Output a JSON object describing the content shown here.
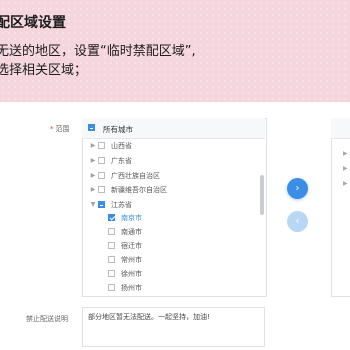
{
  "header": {
    "title": "配区域设置",
    "desc_line1": "无送的地区，设置“临时禁配区域”,",
    "desc_line2": "选择相关区域；"
  },
  "form": {
    "range_required_mark": "*",
    "range_label": "范围",
    "all_cities_label": "所有城市",
    "tree_items": [
      {
        "label": "山西省",
        "expandable": true,
        "checked": false
      },
      {
        "label": "广东省",
        "expandable": true,
        "checked": false
      },
      {
        "label": "广西壮族自治区",
        "expandable": true,
        "checked": false
      },
      {
        "label": "新疆维吾尔自治区",
        "expandable": true,
        "checked": false
      },
      {
        "label": "江苏省",
        "expandable": true,
        "expanded": true,
        "partial": true
      },
      {
        "label": "南京市",
        "checked": true
      },
      {
        "label": "南通市",
        "checked": false
      },
      {
        "label": "宿迁市",
        "checked": false
      },
      {
        "label": "常州市",
        "checked": false
      },
      {
        "label": "徐州市",
        "checked": false
      },
      {
        "label": "扬州市",
        "checked": false
      }
    ],
    "transfer_right_symbol": "›",
    "transfer_left_symbol": "‹",
    "forbid_label": "禁止配送说明",
    "forbid_text": "部分地区暂无法配送。一起坚持，加油!"
  },
  "icons": {
    "expand": "chevron-right-icon",
    "collapse": "chevron-down-icon"
  },
  "colors": {
    "accent": "#3a8ee6",
    "background": "#f5d6df"
  }
}
